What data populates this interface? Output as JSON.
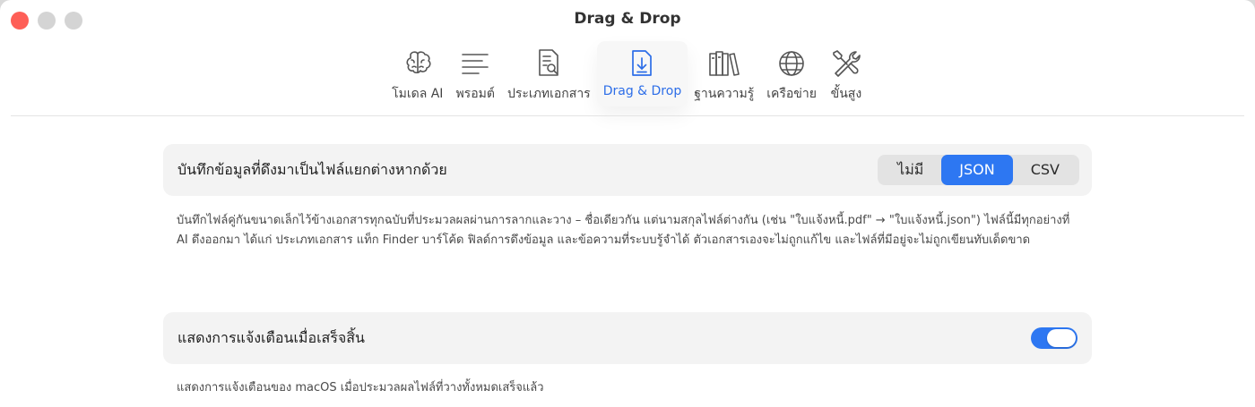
{
  "window": {
    "title": "Drag & Drop"
  },
  "colors": {
    "close": "#fe5f57",
    "minimize": "#d4d4d4",
    "zoom": "#d4d4d4",
    "accent": "#2d77f2"
  },
  "toolbar": {
    "items": [
      {
        "label": "โมเดล AI",
        "icon": "brain-icon",
        "active": false
      },
      {
        "label": "พรอมต์",
        "icon": "text-lines-icon",
        "active": false
      },
      {
        "label": "ประเภทเอกสาร",
        "icon": "document-search-icon",
        "active": false
      },
      {
        "label": "Drag & Drop",
        "icon": "document-download-icon",
        "active": true
      },
      {
        "label": "ฐานความรู้",
        "icon": "books-icon",
        "active": false
      },
      {
        "label": "เครือข่าย",
        "icon": "globe-icon",
        "active": false
      },
      {
        "label": "ขั้นสูง",
        "icon": "tools-icon",
        "active": false
      }
    ]
  },
  "settings": {
    "export": {
      "label": "บันทึกข้อมูลที่ดึงมาเป็นไฟล์แยกต่างหากด้วย",
      "options": [
        "ไม่มี",
        "JSON",
        "CSV"
      ],
      "selected": "JSON",
      "description": "บันทึกไฟล์คู่กันขนาดเล็กไว้ข้างเอกสารทุกฉบับที่ประมวลผลผ่านการลากและวาง – ชื่อเดียวกัน แต่นามสกุลไฟล์ต่างกัน (เช่น \"ใบแจ้งหนี้.pdf\" → \"ใบแจ้งหนี้.json\") ไฟล์นี้มีทุกอย่างที่ AI ดึงออกมา ได้แก่ ประเภทเอกสาร แท็ก Finder บาร์โค้ด ฟิลด์การดึงข้อมูล และข้อความที่ระบบรู้จำได้ ตัวเอกสารเองจะไม่ถูกแก้ไข และไฟล์ที่มีอยู่จะไม่ถูกเขียนทับเด็ดขาด"
    },
    "notify": {
      "label": "แสดงการแจ้งเตือนเมื่อเสร็จสิ้น",
      "enabled": true,
      "description": "แสดงการแจ้งเตือนของ macOS เมื่อประมวลผลไฟล์ที่วางทั้งหมดเสร็จแล้ว"
    }
  }
}
